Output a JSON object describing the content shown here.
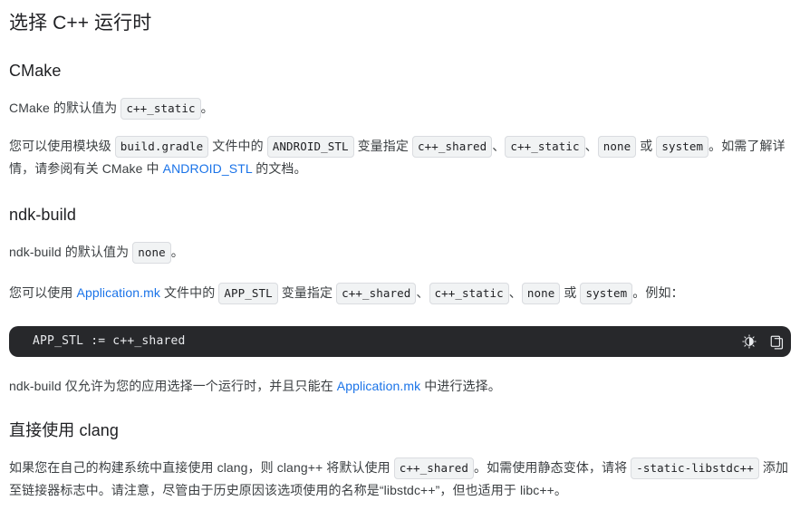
{
  "document": {
    "title": "选择 C++ 运行时"
  },
  "sections": {
    "cmake": {
      "heading": "CMake",
      "default_para": {
        "before": "CMake 的默认值为 ",
        "chip": "c++_static",
        "after": "。"
      },
      "usage_para": {
        "p1": "您可以使用模块级 ",
        "chip_gradle": "build.gradle",
        "p2": " 文件中的 ",
        "chip_var": "ANDROID_STL",
        "p3": " 变量指定 ",
        "chip_opt1": "c++_shared",
        "sep1": "、",
        "chip_opt2": "c++_static",
        "sep2": "、",
        "chip_opt3": "none",
        "p4": " 或 ",
        "chip_opt4": "system",
        "p5": "。如需了解详情，请参阅有关 CMake 中 ",
        "link": "ANDROID_STL",
        "p6": " 的文档。"
      }
    },
    "ndk_build": {
      "heading": "ndk-build",
      "default_para": {
        "before": "ndk-build 的默认值为 ",
        "chip": "none",
        "after": "。"
      },
      "usage_para": {
        "p1": "您可以使用 ",
        "link": "Application.mk",
        "p2": " 文件中的 ",
        "chip_var": "APP_STL",
        "p3": " 变量指定 ",
        "chip_opt1": "c++_shared",
        "sep1": "、",
        "chip_opt2": "c++_static",
        "sep2": "、",
        "chip_opt3": "none",
        "p4": " 或 ",
        "chip_opt4": "system",
        "p5": "。例如："
      },
      "code_block": {
        "code": "APP_STL := c++_shared",
        "dark_mode_icon": "contrast-icon",
        "copy_icon": "copy-icon"
      },
      "note_para": {
        "p1": "ndk-build 仅允许为您的应用选择一个运行时，并且只能在 ",
        "link": "Application.mk",
        "p2": " 中进行选择。"
      }
    },
    "clang": {
      "heading": "直接使用 clang",
      "para": {
        "p1": "如果您在自己的构建系统中直接使用 clang，则 clang++ 将默认使用 ",
        "chip_shared": "c++_shared",
        "p2": "。如需使用静态变体，请将 ",
        "chip_static": "-static-libstdc++",
        "p3": " 添加至链接器标志中。请注意，尽管由于历史原因该选项使用的名称是“libstdc++”，但也适用于 libc++。"
      }
    }
  },
  "colors": {
    "text": "#202124",
    "body_text": "#3c4043",
    "link": "#1a73e8",
    "chip_bg": "#f1f3f4",
    "chip_border": "#dadce0",
    "code_block_bg": "#27282b",
    "code_block_text": "#e8eaed"
  }
}
